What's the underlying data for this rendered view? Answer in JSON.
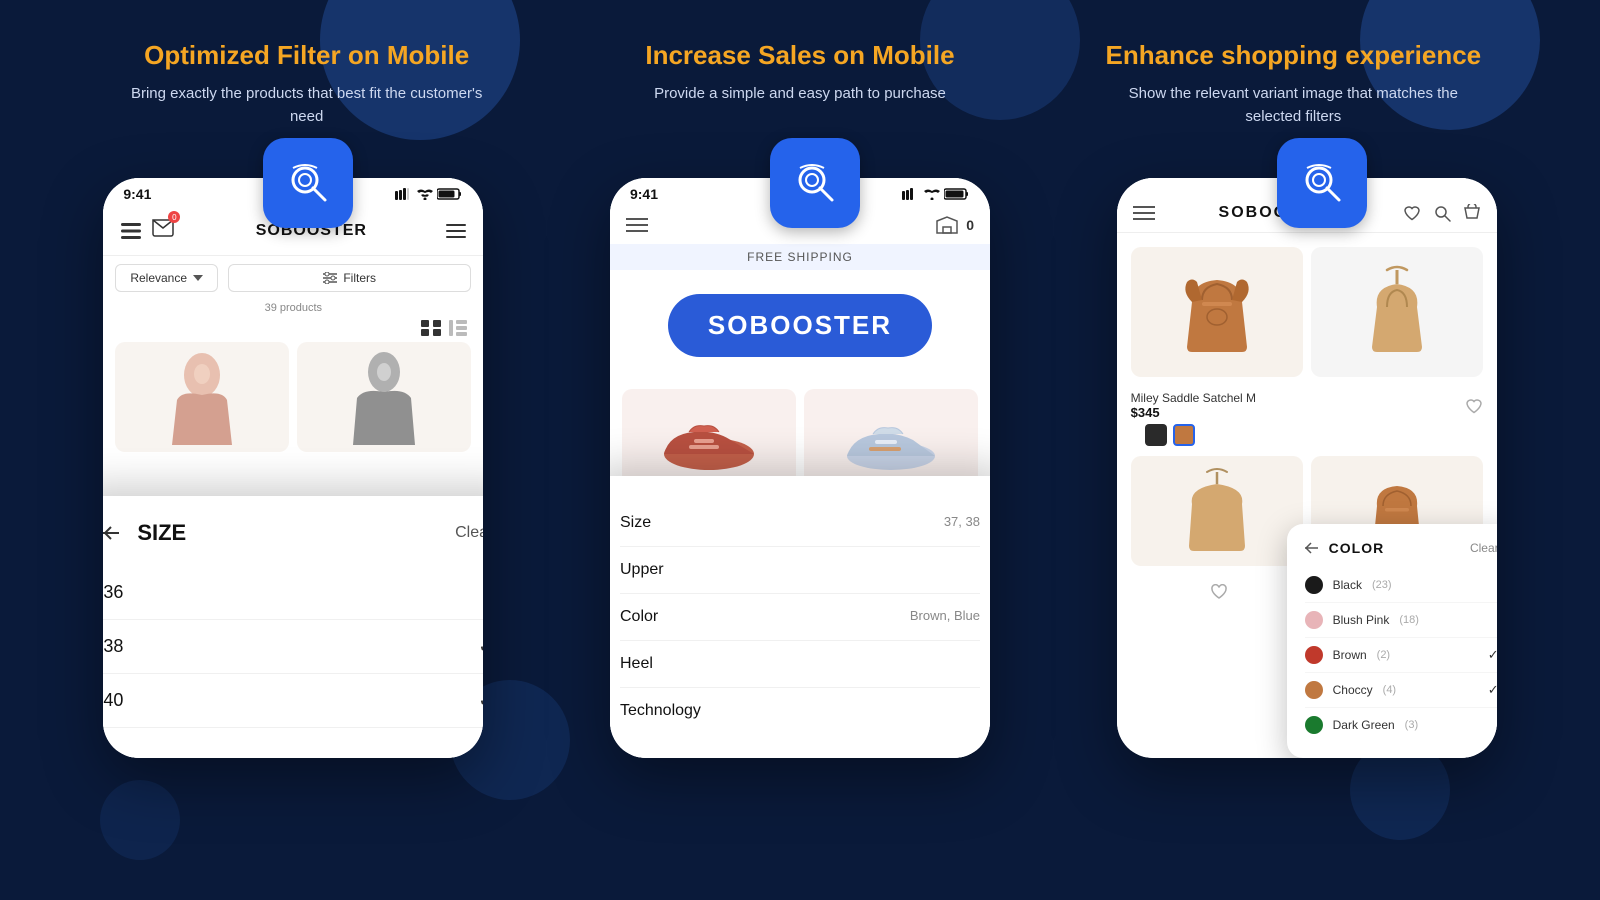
{
  "background": {
    "color": "#0a1a3a"
  },
  "features": [
    {
      "title": "Optimized Filter on Mobile",
      "description": "Bring exactly the products that best fit the customer's need"
    },
    {
      "title": "Increase Sales on Mobile",
      "description": "Provide a simple and easy path to purchase"
    },
    {
      "title": "Enhance shopping experience",
      "description": "Show the relevant variant image that matches the selected filters"
    }
  ],
  "phone1": {
    "time": "9:41",
    "logo": "SOBOOSTER",
    "sort_label": "Relevance",
    "filter_label": "Filters",
    "products_count": "39 products",
    "size_panel": {
      "title": "SIZE",
      "clear_label": "Clear",
      "sizes": [
        {
          "value": "36",
          "selected": false
        },
        {
          "value": "38",
          "selected": true
        },
        {
          "value": "40",
          "selected": true
        }
      ]
    }
  },
  "phone2": {
    "time": "9:41",
    "free_shipping": "FREE SHIPPING",
    "brand": "SOBOOSTER",
    "filter_panel": {
      "items": [
        {
          "label": "Size",
          "value": "37, 38"
        },
        {
          "label": "Upper",
          "value": ""
        },
        {
          "label": "Color",
          "value": "Brown, Blue"
        },
        {
          "label": "Heel",
          "value": ""
        },
        {
          "label": "Technology",
          "value": ""
        }
      ]
    }
  },
  "phone3": {
    "logo": "SOBOOSTER",
    "product": {
      "name": "Miley Saddle Satchel M",
      "price": "$345"
    },
    "color_panel": {
      "title": "COLOR",
      "clear_label": "Clear",
      "colors": [
        {
          "name": "Black",
          "count": "(23)",
          "hex": "#1a1a1a",
          "selected": false
        },
        {
          "name": "Blush Pink",
          "count": "(18)",
          "hex": "#e8b4b8",
          "selected": false
        },
        {
          "name": "Brown",
          "count": "(2)",
          "hex": "#c0392b",
          "selected": true
        },
        {
          "name": "Choccy",
          "count": "(4)",
          "hex": "#c07840",
          "selected": true
        },
        {
          "name": "Dark Green",
          "count": "(3)",
          "hex": "#1a7a2e",
          "selected": false
        }
      ]
    }
  }
}
